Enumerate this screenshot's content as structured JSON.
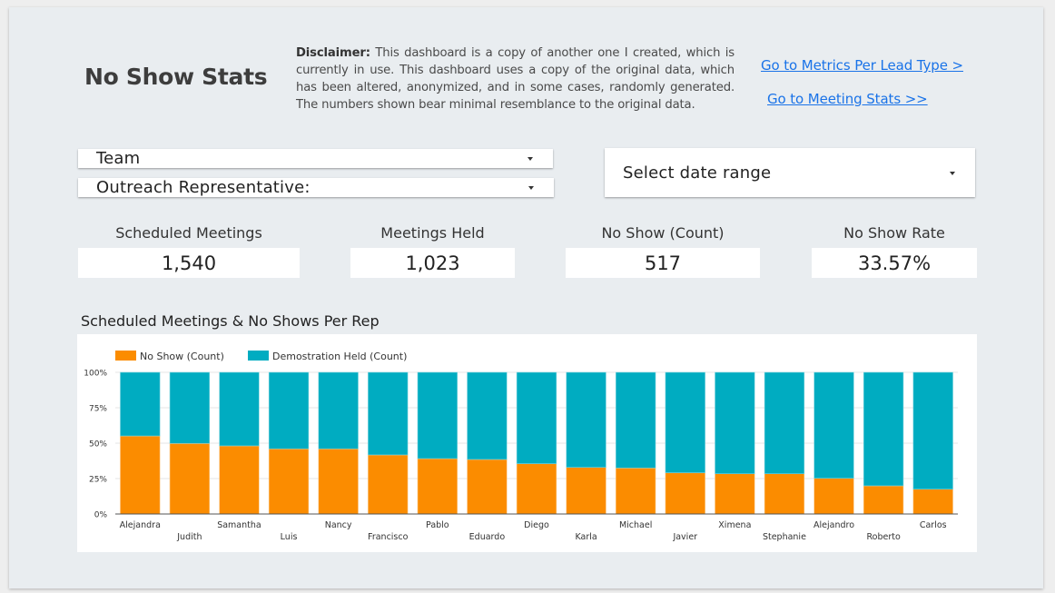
{
  "header": {
    "title": "No Show Stats",
    "disclaimer_bold": "Disclaimer:",
    "disclaimer_text": " This dashboard is a copy of another one I created, which is currently in use. This dashboard uses a copy of the original data, which has been altered, anonymized, and in some cases, randomly generated. The numbers shown bear minimal resemblance to the original data.",
    "links": [
      {
        "label": "Go to Metrics Per Lead Type >"
      },
      {
        "label": "Go to Meeting Stats >>"
      }
    ]
  },
  "filters": {
    "team": {
      "label": "Team",
      "icon": "caret-down-icon"
    },
    "rep": {
      "label": "Outreach Representative:",
      "icon": "caret-down-icon"
    },
    "date_range": {
      "label": "Select date range",
      "icon": "caret-down-icon"
    }
  },
  "kpis": [
    {
      "label": "Scheduled Meetings",
      "value": "1,540"
    },
    {
      "label": "Meetings Held",
      "value": "1,023"
    },
    {
      "label": "No Show (Count)",
      "value": "517"
    },
    {
      "label": "No Show Rate",
      "value": "33.57%"
    }
  ],
  "colors": {
    "no_show": "#fb8c00",
    "held": "#00acc1",
    "link": "#1a73e8"
  },
  "chart_data": {
    "type": "bar",
    "stacked": "100%",
    "title": "Scheduled Meetings & No Shows Per Rep",
    "xlabel": "",
    "ylabel": "",
    "ylim": [
      0,
      100
    ],
    "yticks": [
      "0%",
      "25%",
      "50%",
      "75%",
      "100%"
    ],
    "ytick_values": [
      0,
      25,
      50,
      75,
      100
    ],
    "grid": true,
    "legend_position": "top-left",
    "categories": [
      "Alejandra",
      "Judith",
      "Samantha",
      "Luis",
      "Nancy",
      "Francisco",
      "Pablo",
      "Eduardo",
      "Diego",
      "Karla",
      "Michael",
      "Javier",
      "Ximena",
      "Stephanie",
      "Alejandro",
      "Roberto",
      "Carlos"
    ],
    "series": [
      {
        "name": "No Show (Count)",
        "color": "#fb8c00",
        "values": [
          55.1,
          49.8,
          48.1,
          46.0,
          46.0,
          41.7,
          39.1,
          38.5,
          35.5,
          32.9,
          32.5,
          29.1,
          28.4,
          28.4,
          25.2,
          19.9,
          17.5
        ]
      },
      {
        "name": "Demostration Held (Count)",
        "color": "#00acc1",
        "values": [
          44.9,
          50.2,
          51.9,
          54.0,
          54.0,
          58.3,
          60.9,
          61.5,
          64.5,
          67.1,
          67.5,
          70.9,
          71.6,
          71.6,
          74.8,
          80.1,
          82.5
        ]
      }
    ]
  }
}
